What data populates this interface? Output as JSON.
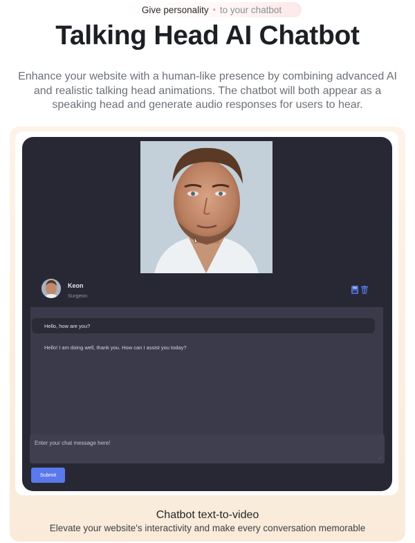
{
  "header": {
    "tagline_strong": "Give personality",
    "tagline_dot": "•",
    "tagline_light": "to your chatbot",
    "title": "Talking Head AI Chatbot",
    "description": "Enhance your website with a human-like presence by combining advanced AI and realistic talking head animations. The chatbot will both appear as a speaking head and generate audio responses for users to hear."
  },
  "demo": {
    "profile": {
      "name": "Keon",
      "role": "Surgeon"
    },
    "messages": [
      {
        "role": "user",
        "text": "Hello, how are you?"
      },
      {
        "role": "assistant",
        "text": "Hello! I am doing well, thank you. How can I assist you today?"
      }
    ],
    "input": {
      "placeholder": "Enter your chat message here!"
    },
    "submit_label": "Submit",
    "icons": {
      "save": "save-icon",
      "delete": "trash-icon"
    },
    "colors": {
      "app_background": "#282834",
      "chat_background": "#3a3a4a",
      "accent": "#5a79ea"
    }
  },
  "caption": {
    "title": "Chatbot text-to-video",
    "subtitle": "Elevate your website's interactivity and make every conversation memorable"
  }
}
